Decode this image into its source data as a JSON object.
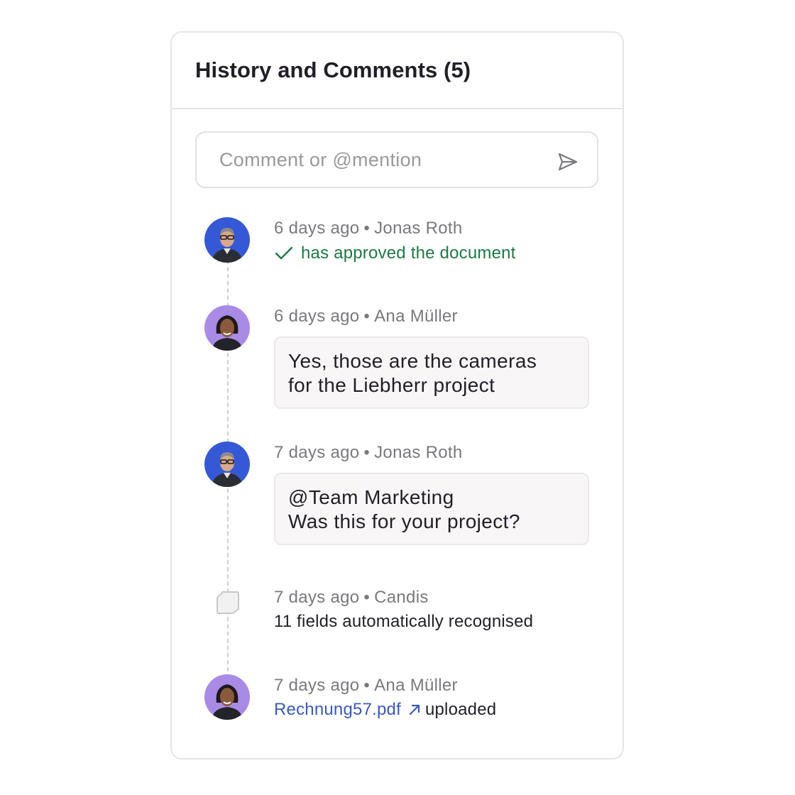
{
  "panel": {
    "title": "History and Comments (5)"
  },
  "comment": {
    "placeholder": "Comment or @mention"
  },
  "icons": {
    "send": "send-icon",
    "check": "check-icon",
    "external": "arrow-up-right-icon",
    "system": "document-icon"
  },
  "colors": {
    "approved_text": "#1c7a45",
    "link": "#3a58c4",
    "avatar_blue": "#3559d6",
    "avatar_purple": "#a98be6"
  },
  "entries": [
    {
      "time": "6 days ago",
      "author": "Jonas Roth",
      "action": "has approved the document"
    },
    {
      "time": "6 days ago",
      "author": "Ana Müller",
      "comment_lines": [
        "Yes, those are the cameras",
        "for the Liebherr project"
      ]
    },
    {
      "time": "7 days ago",
      "author": "Jonas Roth",
      "comment_lines": [
        "@Team Marketing",
        "Was this for your project?"
      ]
    },
    {
      "time": "7 days ago",
      "author": "Candis",
      "action": "11 fields automatically recognised"
    },
    {
      "time": "7 days ago",
      "author": "Ana Müller",
      "file_name": "Rechnung57.pdf",
      "action": "uploaded"
    }
  ],
  "separator": "•"
}
